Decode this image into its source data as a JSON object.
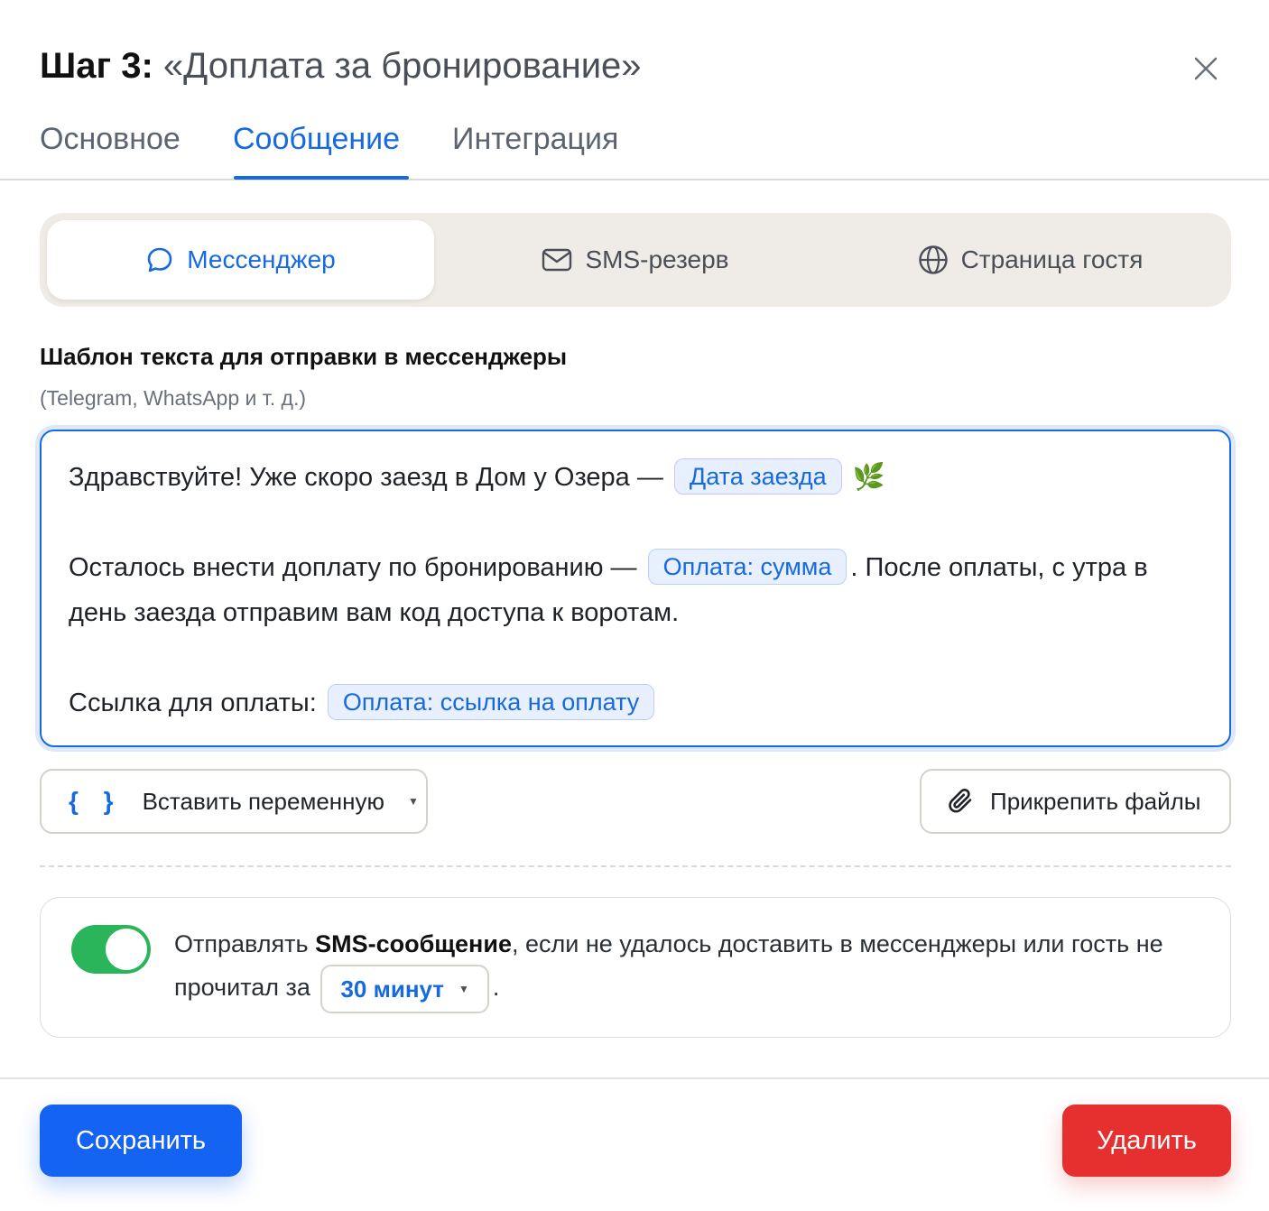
{
  "header": {
    "step_label": "Шаг 3:",
    "step_name": "«Доплата за бронирование»"
  },
  "tabs": [
    {
      "label": "Основное",
      "active": false
    },
    {
      "label": "Сообщение",
      "active": true
    },
    {
      "label": "Интеграция",
      "active": false
    }
  ],
  "channels": [
    {
      "label": "Мессенджер",
      "icon": "chat-bubble-icon",
      "active": true
    },
    {
      "label": "SMS-резерв",
      "icon": "envelope-icon",
      "active": false
    },
    {
      "label": "Страница гостя",
      "icon": "globe-icon",
      "active": false
    }
  ],
  "template": {
    "label": "Шаблон текста для отправки в мессенджеры",
    "sublabel": "(Telegram, WhatsApp и т. д.)",
    "line1_text": "Здравствуйте! Уже скоро заезд в Дом у Озера — ",
    "line1_chip": "Дата заезда",
    "line1_emoji": "🌿",
    "line2_text": "Осталось внести доплату по бронированию — ",
    "line2_chip": "Оплата: сумма",
    "line2_after": ". После оплаты, с утра в день заезда отправим вам код доступа к воротам.",
    "line3_text": "Ссылка для оплаты: ",
    "line3_chip": "Оплата: ссылка на оплату"
  },
  "actions": {
    "insert_braces": "{ }",
    "insert_label": "Вставить переменную",
    "attach_label": "Прикрепить файлы"
  },
  "sms_fallback": {
    "enabled": true,
    "text_before": "Отправлять ",
    "text_bold": "SMS-сообщение",
    "text_middle": ", если не удалось доставить в мессенджеры или гость не прочитал за ",
    "delay_value": "30 минут",
    "text_after": "."
  },
  "footer": {
    "save_label": "Сохранить",
    "delete_label": "Удалить"
  },
  "colors": {
    "accent": "#1769e0",
    "save": "#1463f3",
    "delete": "#e5302f",
    "toggle_on": "#2bb55a"
  }
}
